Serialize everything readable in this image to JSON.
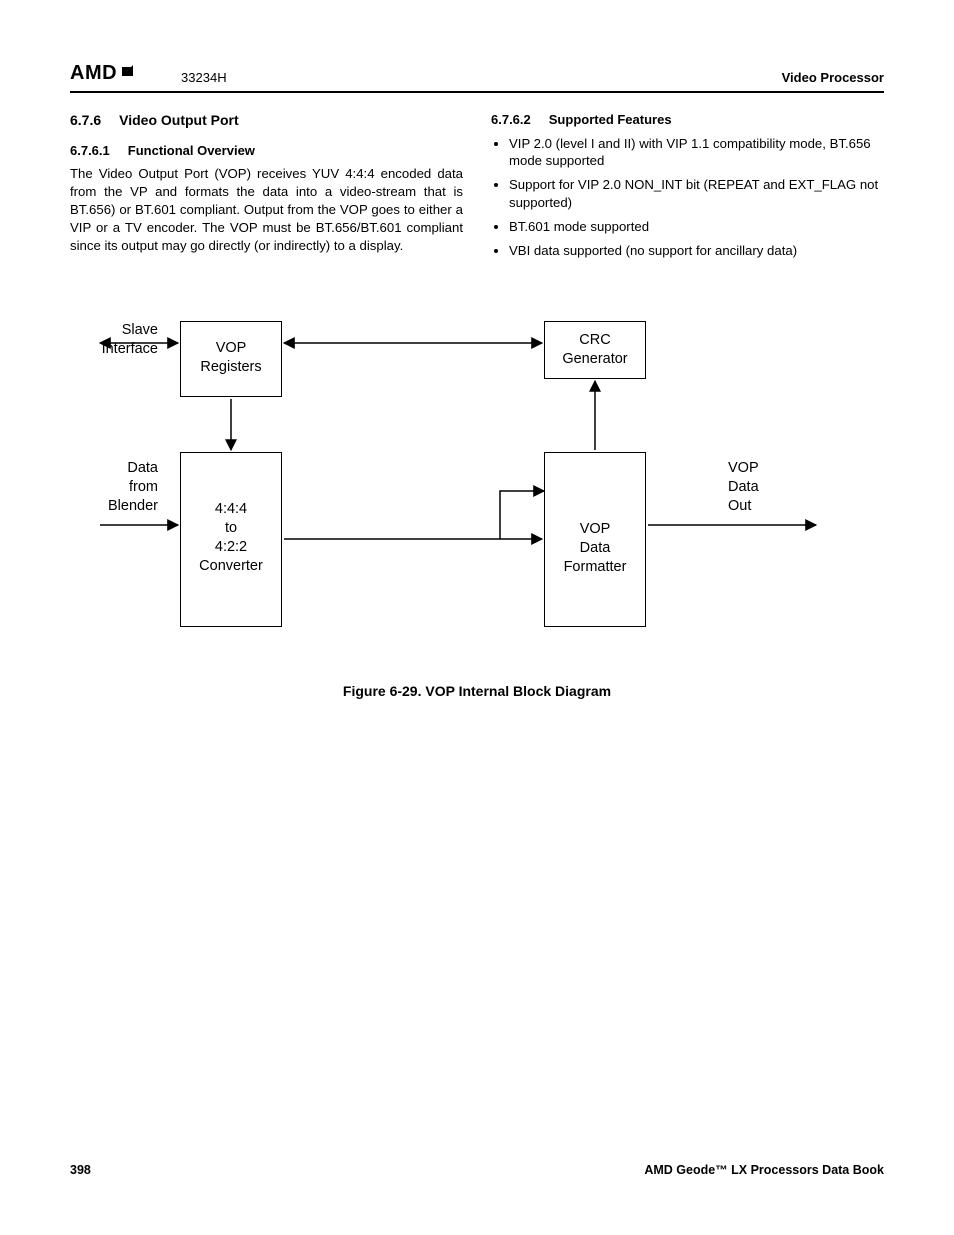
{
  "header": {
    "logo_text": "AMD",
    "doc_number": "33234H",
    "chapter": "Video Processor"
  },
  "left_col": {
    "section_num": "6.7.6",
    "section_title": "Video Output Port",
    "sub_num": "6.7.6.1",
    "sub_title": "Functional Overview",
    "para": "The Video Output Port (VOP) receives YUV 4:4:4 encoded data from the VP and formats the data into a video-stream that is BT.656) or BT.601 compliant. Output from the VOP goes to either a VIP or a TV encoder. The VOP must be BT.656/BT.601 compliant since its output may go directly (or indirectly) to a display."
  },
  "right_col": {
    "sub_num": "6.7.6.2",
    "sub_title": "Supported Features",
    "items": [
      "VIP 2.0 (level I and II) with VIP 1.1 compatibility mode, BT.656 mode supported",
      "Support for VIP 2.0 NON_INT bit (REPEAT and EXT_FLAG not supported)",
      "BT.601 mode supported",
      "VBI data supported (no support for ancillary data)"
    ]
  },
  "diagram": {
    "slave_interface": "Slave\nInterface",
    "vop_registers": "VOP\nRegisters",
    "crc_generator": "CRC\nGenerator",
    "data_from_blender": "Data\nfrom\nBlender",
    "converter": "4:4:4\nto\n4:2:2\nConverter",
    "vop_formatter": "VOP\nData\nFormatter",
    "vop_data_out": "VOP\nData\nOut",
    "caption": "Figure 6-29.  VOP Internal Block Diagram"
  },
  "footer": {
    "page_num": "398",
    "book": "AMD Geode™ LX Processors Data Book"
  }
}
